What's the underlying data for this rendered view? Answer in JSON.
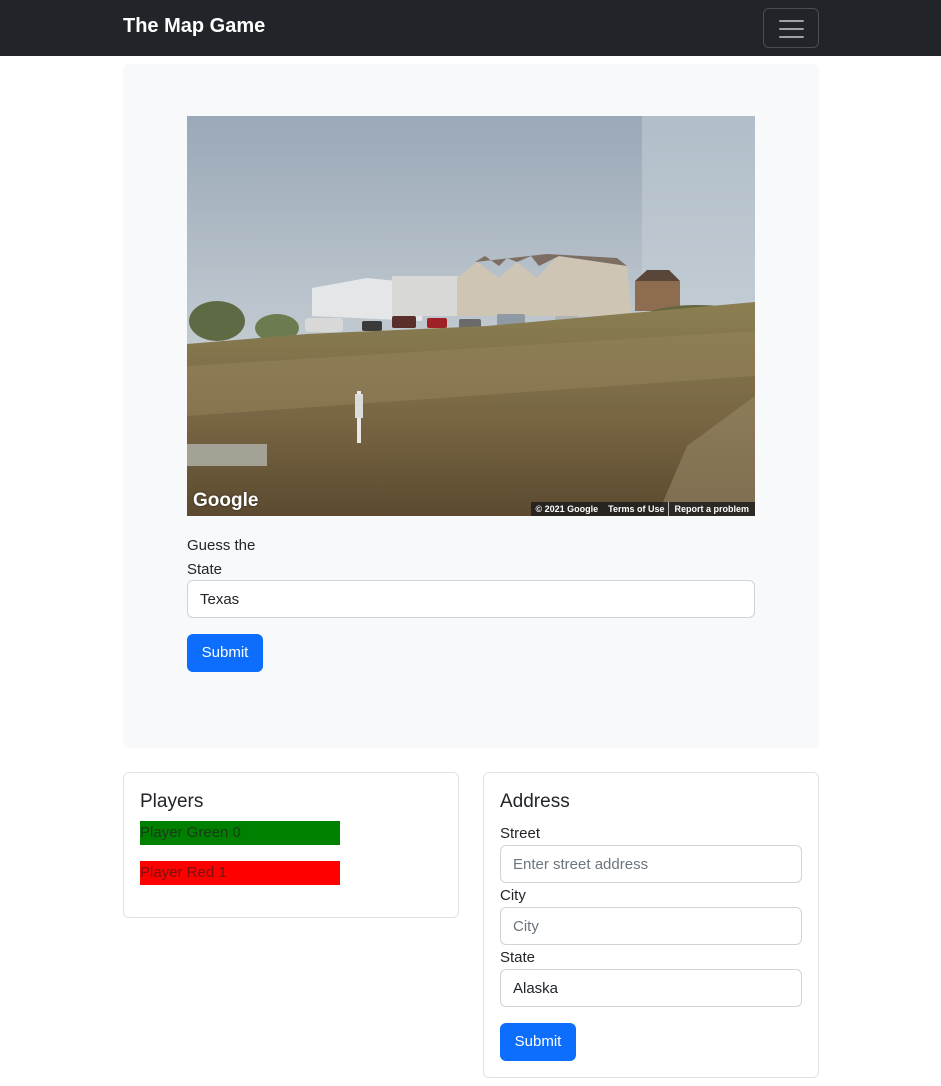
{
  "navbar": {
    "brand": "The Map Game",
    "toggler_icon": "hamburger-menu-icon"
  },
  "game": {
    "streetview": {
      "logo": "Google",
      "copyright": "© 2021 Google",
      "terms": "Terms of Use",
      "report": "Report a problem"
    },
    "guess_label": "Guess the State",
    "guess_value": "Texas",
    "submit_label": "Submit"
  },
  "players": {
    "title": "Players",
    "list": [
      {
        "label": "Player Green 0",
        "color": "#008000"
      },
      {
        "label": "Player Red 1",
        "color": "#ff0000"
      }
    ]
  },
  "address": {
    "title": "Address",
    "street_label": "Street",
    "street_placeholder": "Enter street address",
    "street_value": "",
    "city_label": "City",
    "city_placeholder": "City",
    "city_value": "",
    "state_label": "State",
    "state_value": "Alaska",
    "submit_label": "Submit"
  },
  "colors": {
    "navbar_bg": "#212529",
    "primary": "#0d6efd",
    "panel_bg": "#f8f9fa"
  }
}
